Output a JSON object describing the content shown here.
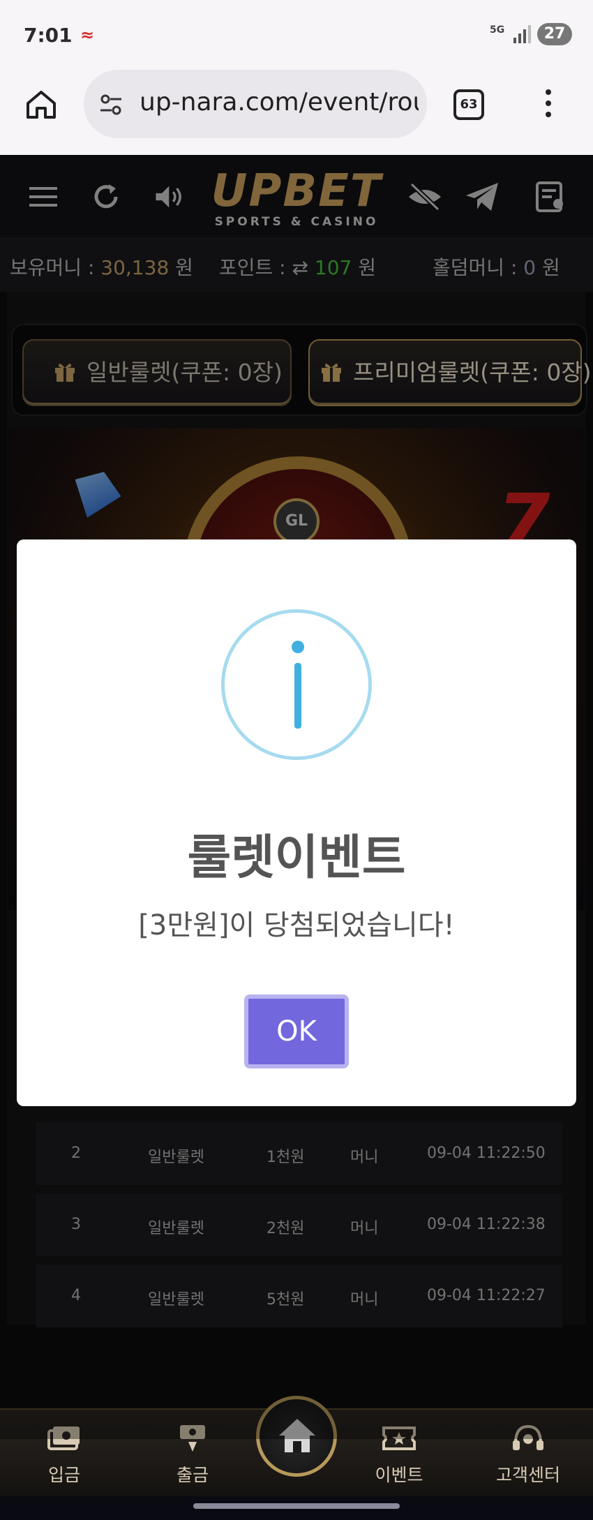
{
  "status_bar": {
    "time": "7:01",
    "network": "5G",
    "battery": "27"
  },
  "browser": {
    "url": "up-nara.com/event/rou",
    "tab_count": "63"
  },
  "site": {
    "logo": "UPBET",
    "logo_sub": "SPORTS & CASINO"
  },
  "money_bar": {
    "hold_label": "보유머니 : ",
    "hold_value": "30,138",
    "hold_unit": " 원",
    "point_label": "포인트 : ",
    "point_value": "107",
    "point_unit": " 원",
    "holdem_label": "홀덤머니 : ",
    "holdem_value": "0",
    "holdem_unit": " 원"
  },
  "tabs": [
    {
      "label": "일반룰렛(쿠폰: 0장)"
    },
    {
      "label": "프리미엄룰렛(쿠폰: 0장)"
    }
  ],
  "banner": {
    "badge": "GL"
  },
  "modal": {
    "title": "룰렛이벤트",
    "message": "[3만원]이 당첨되었습니다!",
    "ok_label": "OK"
  },
  "history": [
    {
      "no": "2",
      "type": "일반룰렛",
      "prize": "1천원",
      "kind": "머니",
      "time": "09-04 11:22:50"
    },
    {
      "no": "3",
      "type": "일반룰렛",
      "prize": "2천원",
      "kind": "머니",
      "time": "09-04 11:22:38"
    },
    {
      "no": "4",
      "type": "일반룰렛",
      "prize": "5천원",
      "kind": "머니",
      "time": "09-04 11:22:27"
    }
  ],
  "bottom_nav": {
    "deposit": "입금",
    "withdraw": "출금",
    "event": "이벤트",
    "support": "고객센터"
  },
  "colors": {
    "accent_gold": "#c8a46a",
    "ok_button": "#7367dd",
    "point_green": "#48c03e"
  }
}
